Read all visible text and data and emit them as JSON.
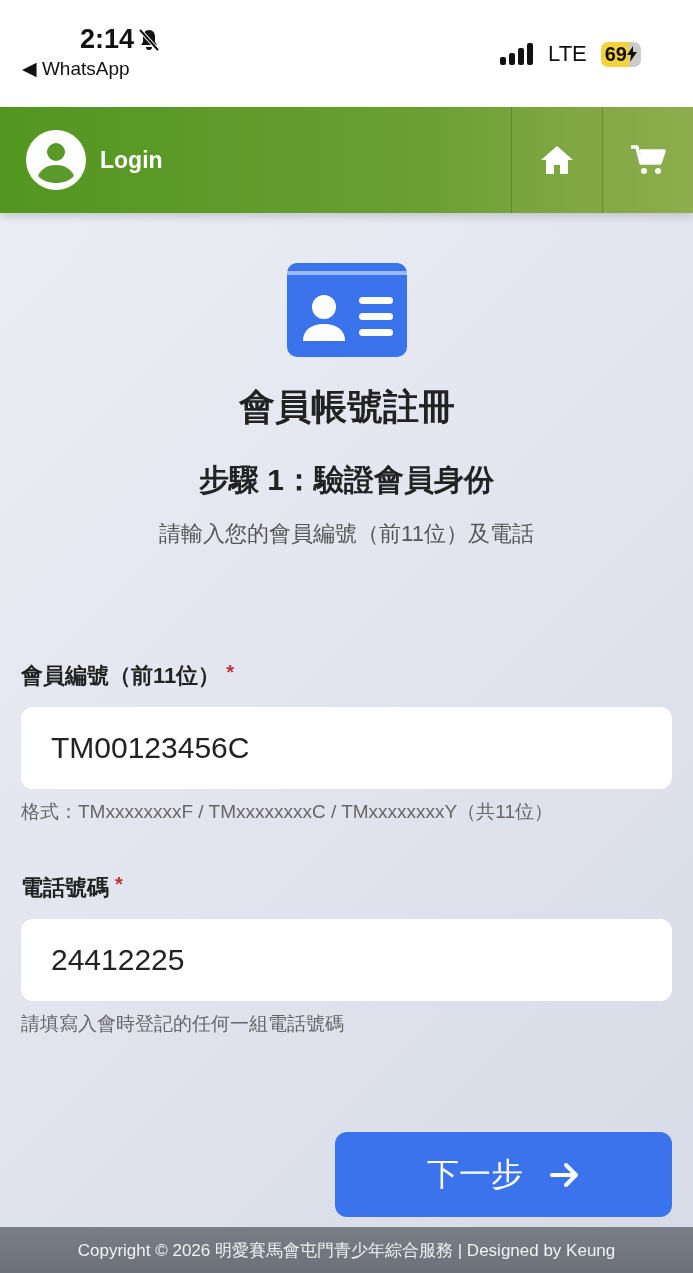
{
  "status_bar": {
    "time": "2:14",
    "silent": true,
    "back_app": "◀ WhatsApp",
    "network": "LTE",
    "battery": "69",
    "charging": true
  },
  "header": {
    "login": "Login"
  },
  "title": "會員帳號註冊",
  "step": "步驟 1：驗證會員身份",
  "subtitle": "請輸入您的會員編號（前11位）及電話",
  "fields": [
    {
      "label": "會員編號（前11位）",
      "required_mark": "*",
      "value": "TM00123456C",
      "hint": "格式：TMxxxxxxxxF / TMxxxxxxxxC / TMxxxxxxxxY（共11位）"
    },
    {
      "label": "電話號碼",
      "required_mark": "*",
      "value": "24412225",
      "hint": "請填寫入會時登記的任何一組電話號碼"
    }
  ],
  "next_button": "下一步",
  "footer": "Copyright © 2026 明愛賽馬會屯門青少年綜合服務 | Designed by Keung"
}
